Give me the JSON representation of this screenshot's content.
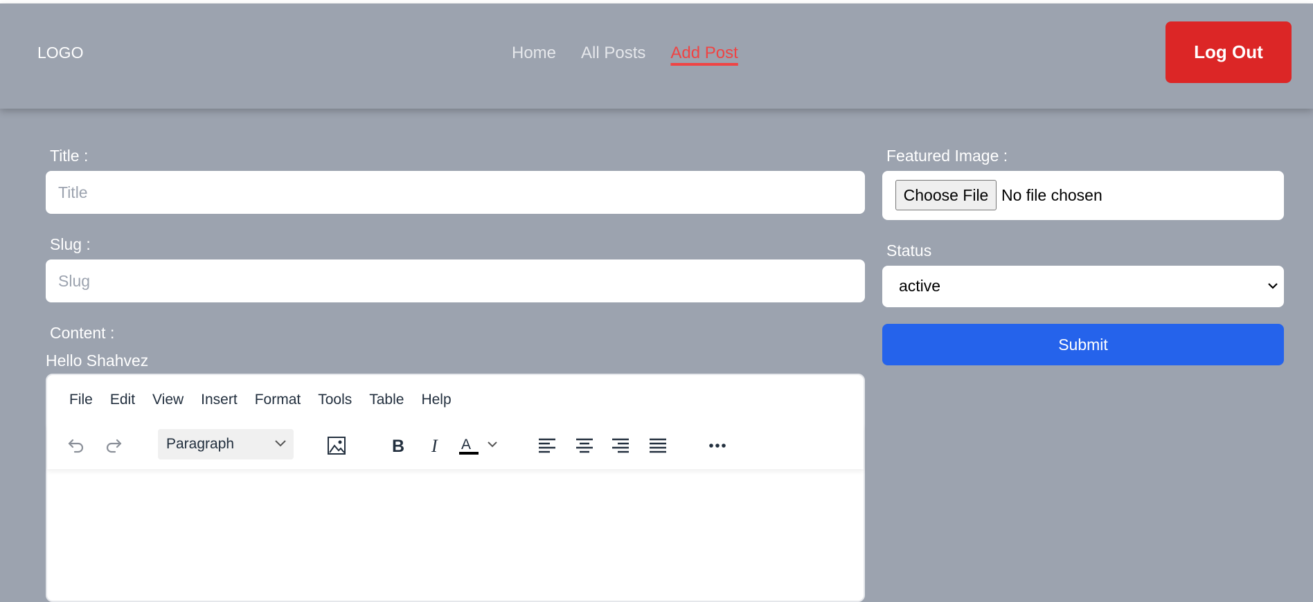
{
  "header": {
    "logo": "LOGO",
    "nav": [
      {
        "label": "Home"
      },
      {
        "label": "All Posts"
      },
      {
        "label": "Add Post"
      }
    ],
    "logout_label": "Log Out"
  },
  "form": {
    "title_label": "Title :",
    "title_placeholder": "Title",
    "slug_label": "Slug :",
    "slug_placeholder": "Slug",
    "content_label": "Content :",
    "greeting": "Hello Shahvez",
    "featured_label": "Featured Image :",
    "file_button": "Choose File",
    "file_status": "No file chosen",
    "status_label": "Status",
    "status_value": "active",
    "submit_label": "Submit"
  },
  "editor": {
    "menu": [
      "File",
      "Edit",
      "View",
      "Insert",
      "Format",
      "Tools",
      "Table",
      "Help"
    ],
    "block_format": "Paragraph",
    "toolbar_icons": [
      "undo-icon",
      "redo-icon",
      "image-icon",
      "bold-icon",
      "italic-icon",
      "text-color-icon",
      "align-left-icon",
      "align-center-icon",
      "align-right-icon",
      "align-justify-icon",
      "more-icon"
    ]
  },
  "colors": {
    "background": "#9ca3af",
    "active_nav": "#ef4444",
    "logout": "#dc2626",
    "submit": "#2563eb"
  }
}
